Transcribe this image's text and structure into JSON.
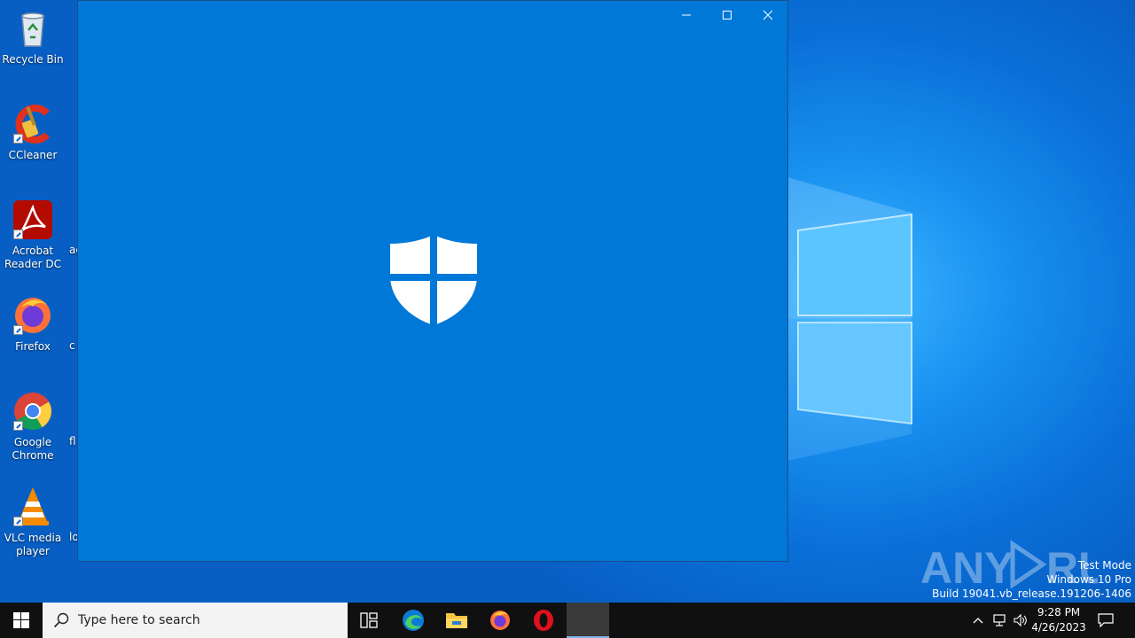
{
  "desktop": {
    "icons": [
      {
        "label": "Recycle Bin",
        "icon": "recycle-bin-icon"
      },
      {
        "label": "CCleaner",
        "icon": "ccleaner-icon"
      },
      {
        "label": "Acrobat Reader DC",
        "icon": "acrobat-icon"
      },
      {
        "label": "Firefox",
        "icon": "firefox-icon"
      },
      {
        "label": "Google Chrome",
        "icon": "chrome-icon"
      },
      {
        "label": "VLC media player",
        "icon": "vlc-icon"
      }
    ],
    "peek_labels": [
      "ac",
      "c",
      "fl",
      "lo"
    ]
  },
  "app_window": {
    "background": "#0078d7",
    "icon": "windows-security-shield-icon",
    "controls": {
      "minimize": "minimize",
      "maximize": "maximize",
      "close": "close"
    }
  },
  "taskbar": {
    "search_placeholder": "Type here to search",
    "apps": [
      "task-view",
      "edge",
      "file-explorer",
      "firefox",
      "opera",
      "windows-security"
    ],
    "clock": {
      "time": "9:28 PM",
      "date": "4/26/2023"
    }
  },
  "system_info": {
    "line1": "Test Mode",
    "line2": "Windows 10 Pro",
    "line3": "Build 19041.vb_release.191206-1406"
  },
  "watermark": {
    "text": "ANY RUN"
  }
}
